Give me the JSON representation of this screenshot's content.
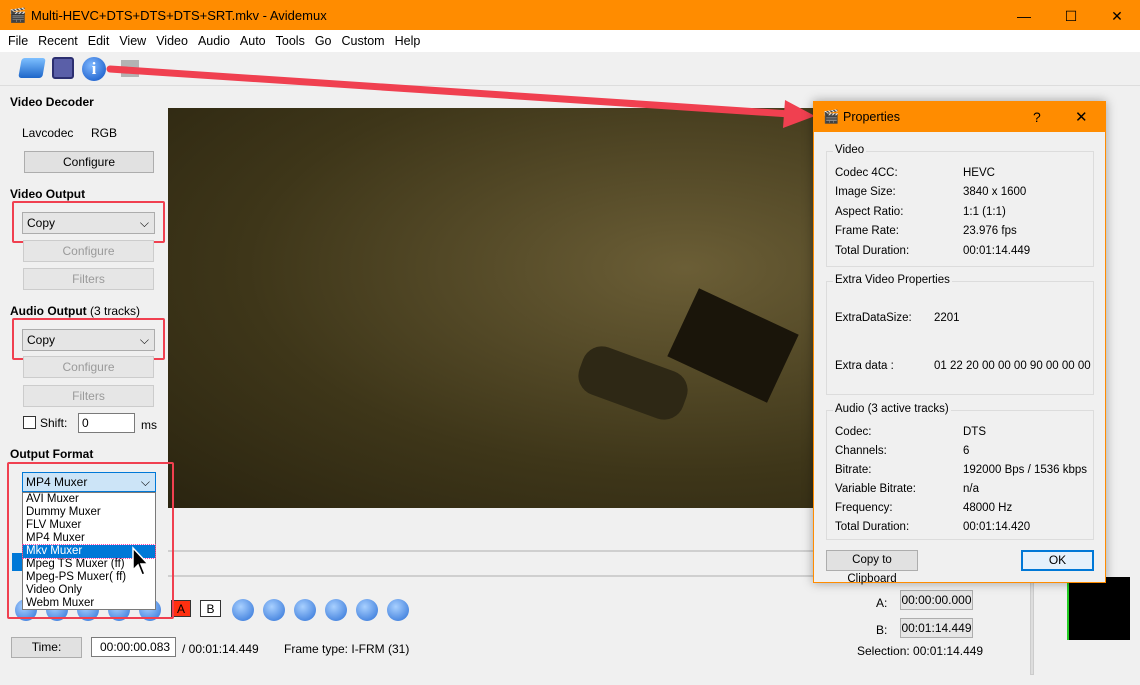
{
  "window": {
    "title": "Multi-HEVC+DTS+DTS+DTS+SRT.mkv - Avidemux",
    "minimize": "—",
    "maximize": "☐",
    "close": "✕"
  },
  "menu": [
    "File",
    "Recent",
    "Edit",
    "View",
    "Video",
    "Audio",
    "Auto",
    "Tools",
    "Go",
    "Custom",
    "Help"
  ],
  "toolbar": {
    "icons": [
      "open-folder-icon",
      "save-disk-icon",
      "info-icon",
      "film-icon"
    ]
  },
  "left": {
    "video_decoder": {
      "heading": "Video Decoder",
      "codec": "Lavcodec",
      "format": "RGB",
      "configure": "Configure"
    },
    "video_output": {
      "heading": "Video Output",
      "value": "Copy",
      "configure": "Configure",
      "filters": "Filters"
    },
    "audio_output": {
      "heading": "Audio Output",
      "tracks": "(3 tracks)",
      "value": "Copy",
      "configure": "Configure",
      "filters": "Filters",
      "shift_label": "Shift:",
      "shift_value": "0",
      "shift_unit": "ms"
    },
    "output_format": {
      "heading": "Output Format",
      "value": "MP4 Muxer",
      "options": [
        "AVI Muxer",
        "Dummy Muxer",
        "FLV Muxer",
        "MP4 Muxer",
        "Mkv Muxer",
        "Mpeg TS Muxer (ff)",
        "Mpeg-PS Muxer( ff)",
        "Video Only",
        "Webm Muxer"
      ],
      "highlighted": "Mkv Muxer"
    }
  },
  "bottom": {
    "time_button": "Time:",
    "time_value": "00:00:00.083",
    "total": "/ 00:01:14.449",
    "frame_type": "Frame type:  I-FRM (31)",
    "marker_a": "A",
    "marker_b": "B",
    "a_label": "A:",
    "a_value": "00:00:00.000",
    "b_label": "B:",
    "b_value": "00:01:14.449",
    "selection": "Selection: 00:01:14.449"
  },
  "properties": {
    "title": "Properties",
    "help": "?",
    "close": "✕",
    "video": {
      "heading": "Video",
      "rows": [
        [
          "Codec 4CC:",
          "HEVC"
        ],
        [
          "Image Size:",
          "3840 x 1600"
        ],
        [
          "Aspect Ratio:",
          "1:1 (1:1)"
        ],
        [
          "Frame Rate:",
          "23.976 fps"
        ],
        [
          "Total Duration:",
          "00:01:14.449"
        ]
      ]
    },
    "extra": {
      "heading": "Extra Video Properties",
      "rows": [
        [
          "ExtraDataSize:",
          "2201"
        ],
        [
          "Extra data :",
          "01 22 20 00 00 00 90 00 00 00"
        ]
      ]
    },
    "audio": {
      "heading": "Audio (3 active tracks)",
      "rows": [
        [
          "Codec:",
          "DTS"
        ],
        [
          "Channels:",
          "6"
        ],
        [
          "Bitrate:",
          "192000 Bps / 1536 kbps"
        ],
        [
          "Variable Bitrate:",
          "n/a"
        ],
        [
          "Frequency:",
          "48000 Hz"
        ],
        [
          "Total Duration:",
          "00:01:14.420"
        ]
      ]
    },
    "copy": "Copy to Clipboard",
    "ok": "OK"
  },
  "colors": {
    "titlebar": "#ff8c00",
    "annotation": "#f04050",
    "selection": "#0078d7"
  }
}
